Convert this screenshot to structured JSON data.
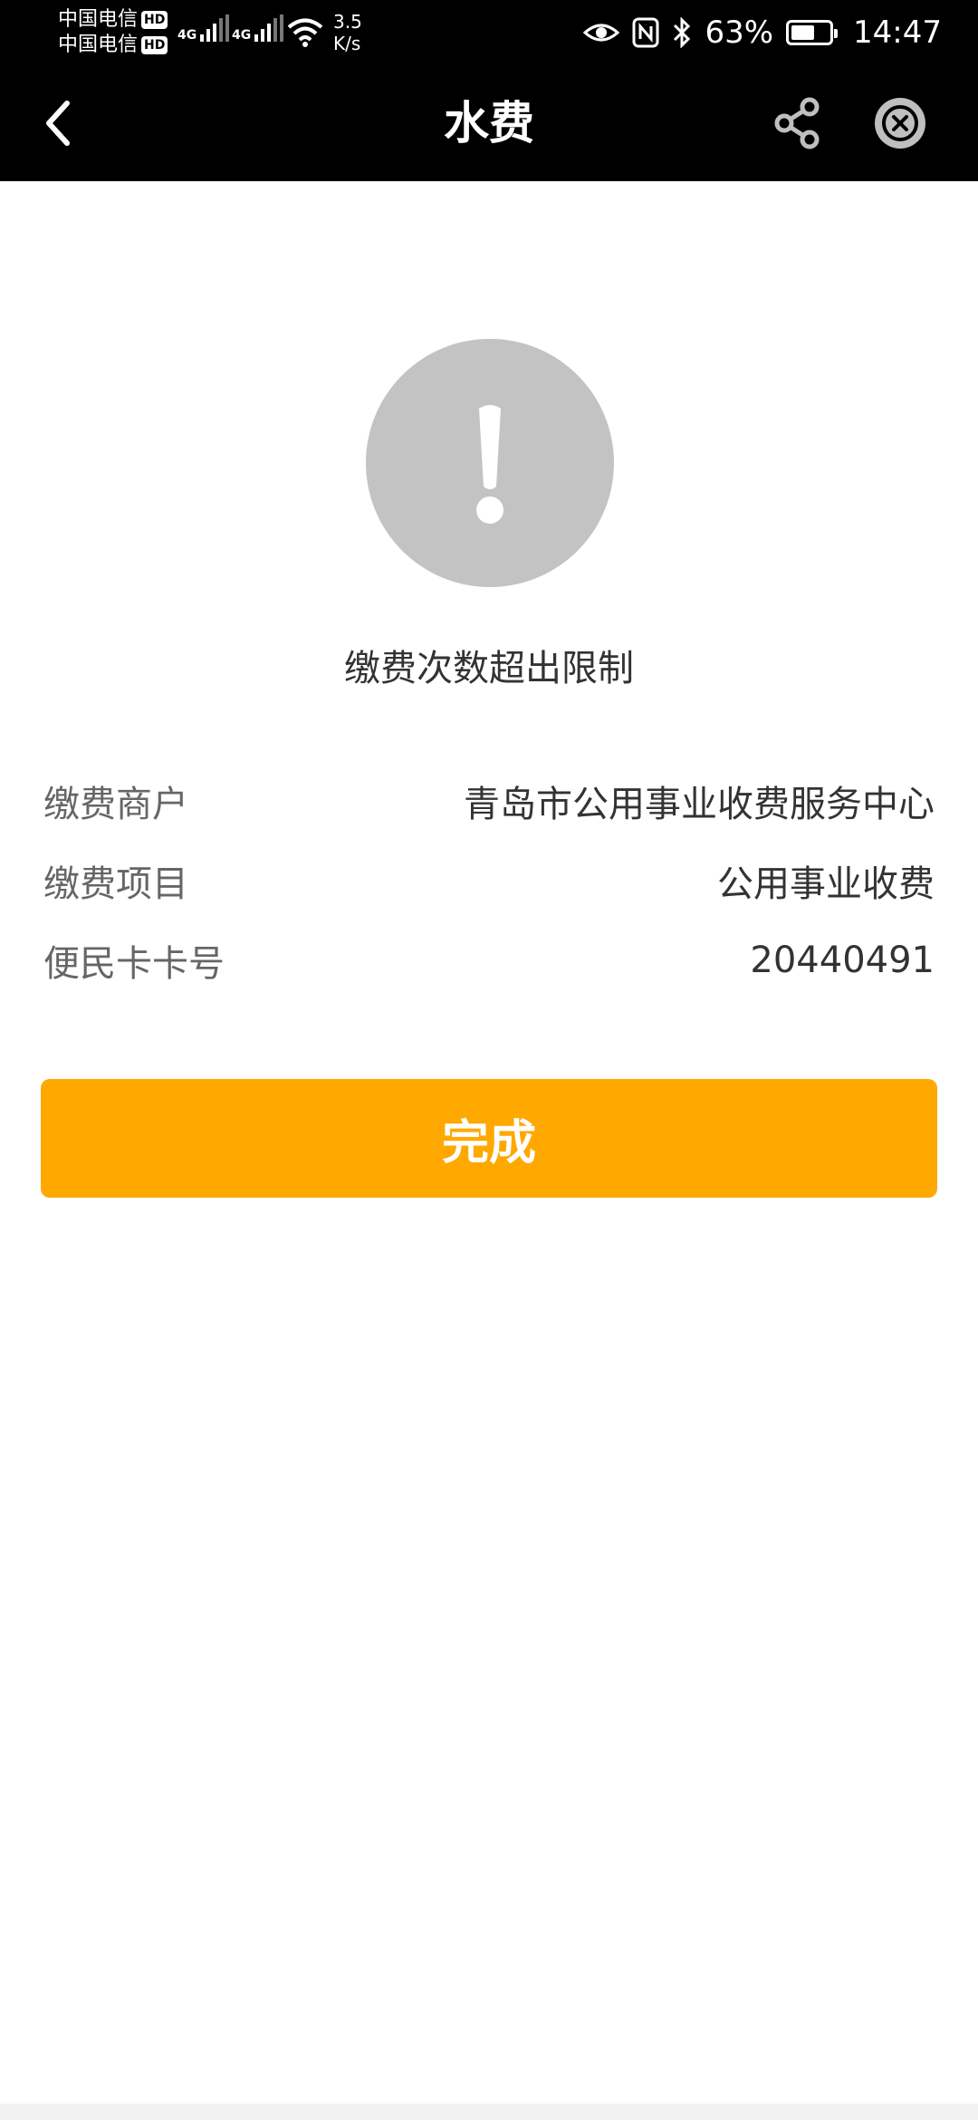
{
  "status_bar": {
    "carrier_1": "中国电信",
    "carrier_2": "中国电信",
    "hd_badge": "HD",
    "network_1": "4G",
    "network_2": "4G",
    "speed_value": "3.5",
    "speed_unit": "K/s",
    "battery_percent": "63%",
    "battery_level": 0.63,
    "time": "14:47"
  },
  "nav": {
    "title": "水费",
    "icons": [
      "back-icon",
      "share-icon",
      "close-icon"
    ]
  },
  "result": {
    "icon": "exclamation-icon",
    "message": "缴费次数超出限制"
  },
  "info": {
    "merchant_label": "缴费商户",
    "merchant_value": "青岛市公用事业收费服务中心",
    "item_label": "缴费项目",
    "item_value": "公用事业收费",
    "card_label": "便民卡卡号",
    "card_value": "20440491"
  },
  "actions": {
    "done_label": "完成"
  },
  "colors": {
    "accent": "#ffa800",
    "header_bg": "#000000",
    "alert_circle": "#c3c3c3"
  }
}
